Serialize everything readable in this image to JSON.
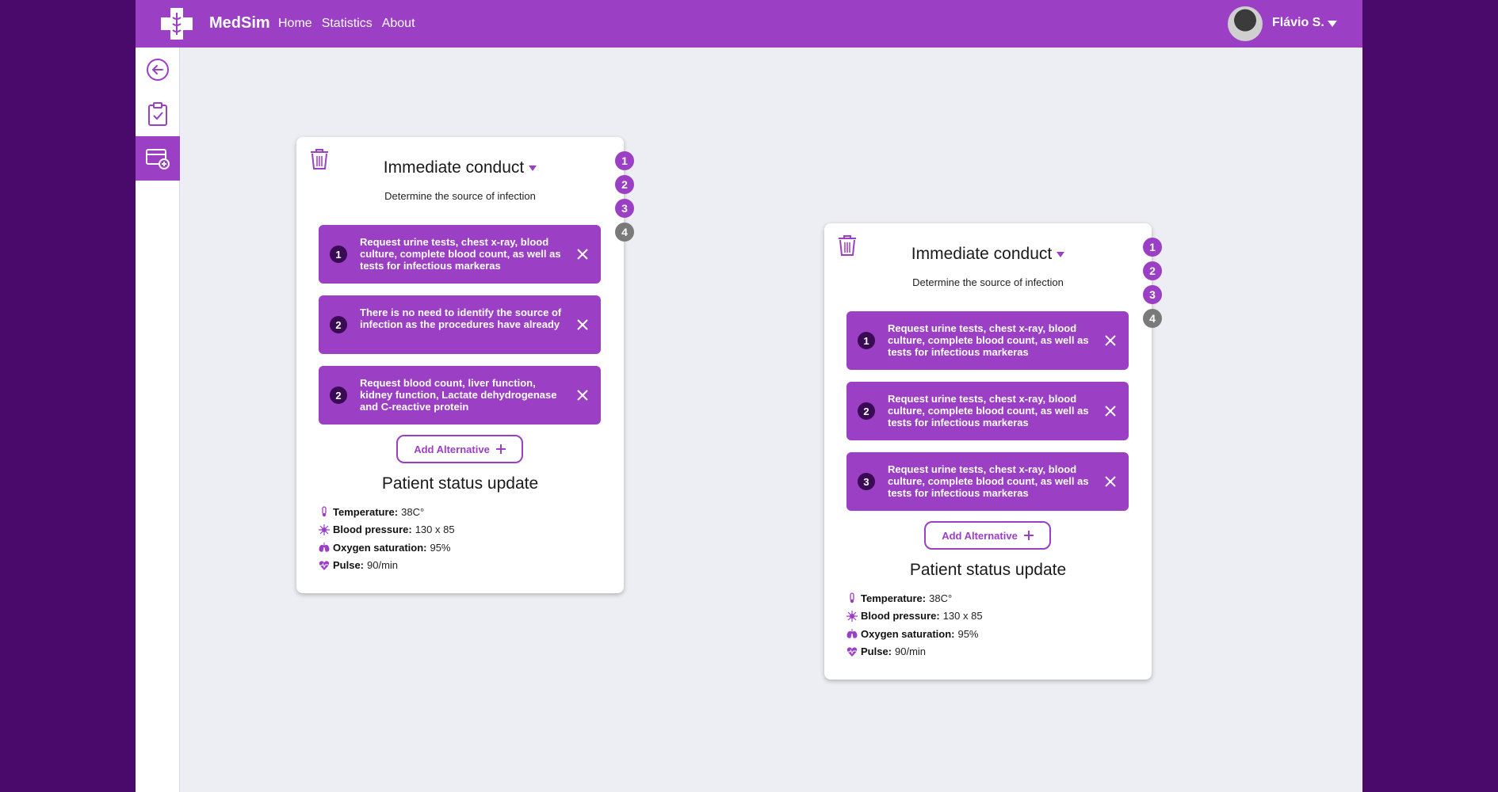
{
  "header": {
    "brand": "MedSim",
    "nav": [
      "Home",
      "Statistics",
      "About"
    ],
    "user_name": "Flávio S."
  },
  "sidebar": {
    "items": [
      {
        "icon": "back-arrow-icon"
      },
      {
        "icon": "clipboard-check-icon"
      },
      {
        "icon": "add-card-icon"
      }
    ]
  },
  "cards": [
    {
      "title": "Immediate conduct",
      "subtitle": "Determine the source of infection",
      "steps": [
        "1",
        "2",
        "3",
        "4"
      ],
      "alternatives": [
        {
          "num": "1",
          "text": "Request urine tests, chest x-ray, blood culture, complete blood count, as well as tests for infectious markeras"
        },
        {
          "num": "2",
          "text": "There is no need to identify the source of infection as the procedures have already"
        },
        {
          "num": "2",
          "text": "Request blood count, liver function, kidney function, Lactate dehydrogenase and C-reactive protein"
        }
      ],
      "add_alternative": "Add Alternative",
      "status_title": "Patient status update",
      "status": [
        {
          "label": "Temperature:",
          "value": "38C°"
        },
        {
          "label": "Blood pressure:",
          "value": "130 x 85"
        },
        {
          "label": "Oxygen saturation:",
          "value": "95%"
        },
        {
          "label": "Pulse:",
          "value": "90/min"
        }
      ]
    },
    {
      "title": "Immediate conduct",
      "subtitle": "Determine the source of infection",
      "steps": [
        "1",
        "2",
        "3",
        "4"
      ],
      "alternatives": [
        {
          "num": "1",
          "text": "Request urine tests, chest x-ray, blood culture, complete blood count, as well as tests for infectious markeras"
        },
        {
          "num": "2",
          "text": "Request urine tests, chest x-ray, blood culture, complete blood count, as well as tests for infectious markeras"
        },
        {
          "num": "3",
          "text": "Request urine tests, chest x-ray, blood culture, complete blood count, as well as tests for infectious markeras"
        }
      ],
      "add_alternative": "Add Alternative",
      "status_title": "Patient status update",
      "status": [
        {
          "label": "Temperature:",
          "value": "38C°"
        },
        {
          "label": "Blood pressure:",
          "value": "130 x 85"
        },
        {
          "label": "Oxygen saturation:",
          "value": "95%"
        },
        {
          "label": "Pulse:",
          "value": "90/min"
        }
      ]
    }
  ],
  "colors": {
    "primary": "#9b3fc4",
    "outer_background": "#4a0a6b",
    "canvas_background": "#edeef3",
    "step_inactive": "#7a7a7a"
  }
}
